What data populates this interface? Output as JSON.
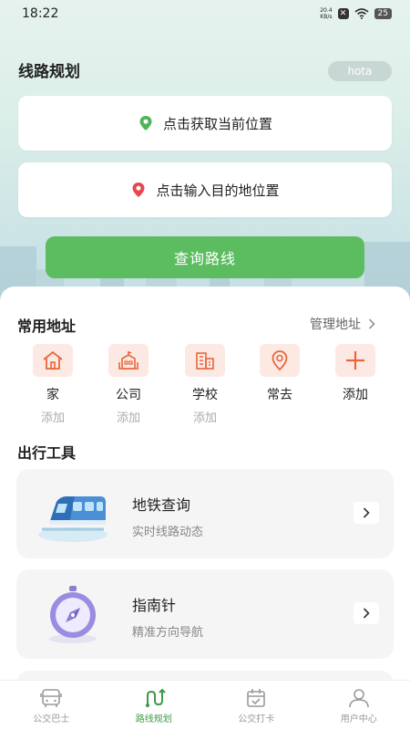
{
  "status_bar": {
    "time": "18:22",
    "net_speed_value": "20.4",
    "net_speed_unit": "KB/s",
    "battery": "25"
  },
  "header": {
    "title": "线路规划",
    "user_pill": "hota"
  },
  "location": {
    "current_label": "点击获取当前位置",
    "destination_label": "点击输入目的地位置",
    "current_icon": "green-location-pin-icon",
    "destination_icon": "red-location-pin-icon"
  },
  "query_button": "查询路线",
  "common_address": {
    "title": "常用地址",
    "manage_label": "管理地址",
    "items": [
      {
        "label": "家",
        "sub": "添加",
        "icon": "house-icon"
      },
      {
        "label": "公司",
        "sub": "添加",
        "icon": "company-icon"
      },
      {
        "label": "学校",
        "sub": "添加",
        "icon": "school-building-icon"
      },
      {
        "label": "常去",
        "sub": "",
        "icon": "location-pin-icon"
      },
      {
        "label": "添加",
        "sub": "",
        "icon": "plus-icon"
      }
    ]
  },
  "tools": {
    "title": "出行工具",
    "items": [
      {
        "name": "地铁查询",
        "desc": "实时线路动态",
        "icon": "subway-train-icon"
      },
      {
        "name": "指南针",
        "desc": "精准方向导航",
        "icon": "compass-icon"
      }
    ]
  },
  "tabbar": {
    "items": [
      {
        "label": "公交巴士",
        "icon": "bus-icon"
      },
      {
        "label": "路线规划",
        "icon": "route-icon"
      },
      {
        "label": "公交打卡",
        "icon": "calendar-checkin-icon"
      },
      {
        "label": "用户中心",
        "icon": "user-icon"
      }
    ],
    "active_index": 1
  },
  "colors": {
    "accent_green": "#5cbd60",
    "icon_orange": "#e8673a",
    "icon_bg": "#fde9e4"
  }
}
